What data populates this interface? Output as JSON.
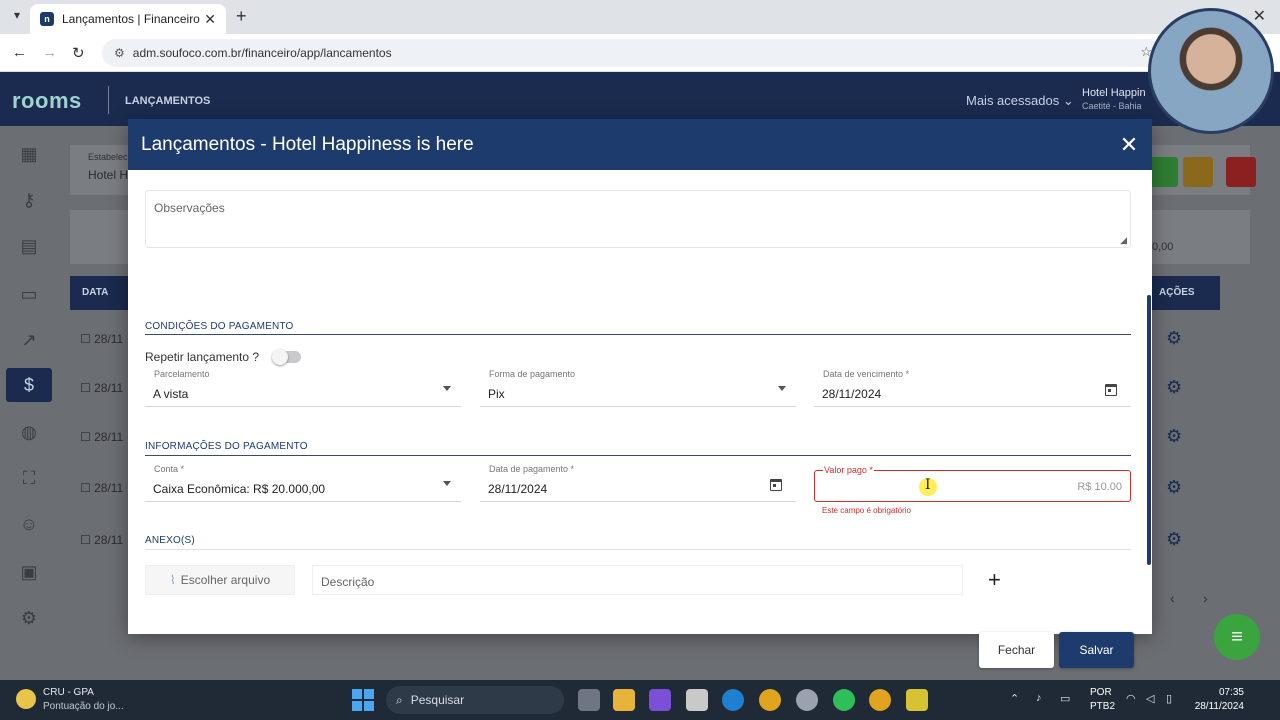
{
  "browser": {
    "tab_title": "Lançamentos | Financeiro",
    "url": "adm.soufoco.com.br/financeiro/app/lancamentos"
  },
  "app": {
    "logo": "rooms",
    "section": "LANÇAMENTOS",
    "mais_acessados": "Mais acessados",
    "hotel_name": "Hotel Happin",
    "hotel_city": "Caetité - Bahia",
    "bg_estab_label": "Estabelec",
    "bg_estab_value": "Hotel H",
    "bg_col_data": "DATA",
    "bg_col_acoes": "AÇÕES",
    "bg_amount": "0,00",
    "bg_row_dates": [
      "28/11",
      "28/11",
      "28/11",
      "28/11",
      "28/11"
    ]
  },
  "modal": {
    "title": "Lançamentos - Hotel Happiness is here",
    "observacoes_label": "Observações",
    "section_condicoes": "CONDIÇÕES DO PAGAMENTO",
    "repeat_label": "Repetir lançamento ?",
    "repeat_on": false,
    "parcelamento_label": "Parcelamento",
    "parcelamento_value": "A vista",
    "forma_label": "Forma de pagamento",
    "forma_value": "Pix",
    "vencimento_label": "Data de vencimento *",
    "vencimento_value": "28/11/2024",
    "section_informacoes": "INFORMAÇÕES DO PAGAMENTO",
    "conta_label": "Conta *",
    "conta_value": "Caixa Econômica: R$ 20.000,00",
    "data_pagamento_label": "Data de pagamento *",
    "data_pagamento_value": "28/11/2024",
    "valor_label": "Valor pago *",
    "valor_placeholder": "R$ 10.00",
    "valor_error": "Este campo é obrigatório",
    "section_anexos": "ANEXO(S)",
    "escolher_arquivo": "Escolher arquivo",
    "descricao_placeholder": "Descrição",
    "fechar": "Fechar",
    "salvar": "Salvar"
  },
  "taskbar": {
    "game_title": "CRU - GPA",
    "game_subtitle": "Pontuação do jo...",
    "search_placeholder": "Pesquisar",
    "lang1": "POR",
    "lang2": "PTB2",
    "time": "07:35",
    "date": "28/11/2024"
  },
  "colors": {
    "header": "#1a2b4f",
    "modal_header": "#1e3b6e",
    "error": "#d32f2f",
    "fab": "#3aa53f"
  }
}
